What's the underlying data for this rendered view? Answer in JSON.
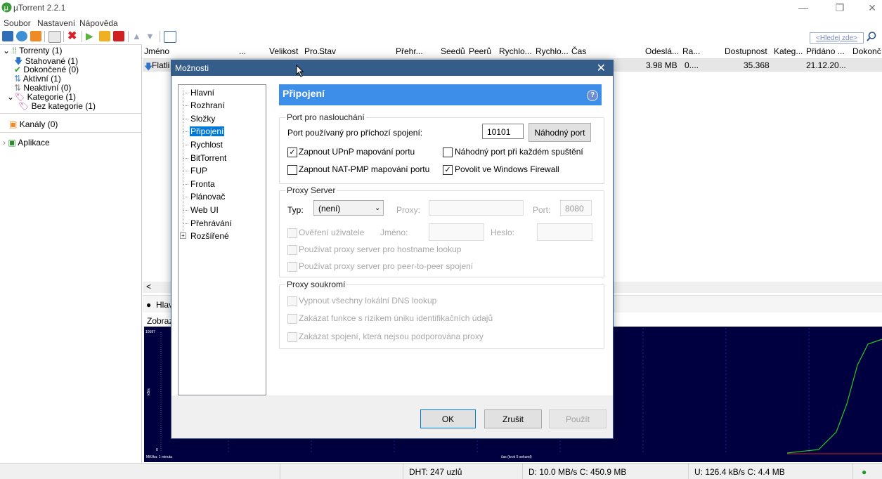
{
  "app": {
    "title": "µTorrent 2.2.1"
  },
  "menu": [
    "Soubor",
    "Nastavení",
    "Nápověda"
  ],
  "search": {
    "placeholder": "<Hledej zde>"
  },
  "sidebar": {
    "torrents": "Torrenty (1)",
    "items": [
      "Stahované (1)",
      "Dokončené (0)",
      "Aktivní (1)",
      "Neaktivní (0)"
    ],
    "categories": "Kategorie (1)",
    "no_category": "Bez kategorie (1)",
    "channels": "Kanály (0)",
    "apps": "Aplikace"
  },
  "grid": {
    "columns": [
      "Jméno",
      "...",
      "Velikost",
      "Pro...",
      "Stav",
      "Přehr...",
      "Seedů",
      "Peerů",
      "Rychlo...",
      "Rychlo...",
      "Čas",
      "Odeslá...",
      "Ra...",
      "Dostupnost",
      "Kateg...",
      "Přidáno ...",
      "Dokonč"
    ],
    "row": {
      "name": "Flatli",
      "uploaded": "3.98 MB",
      "ratio": "0....",
      "availability": "35.368",
      "added": "21.12.20..."
    }
  },
  "lower": {
    "tab": "Hlav",
    "view_label": "Zobraz",
    "graph_ymax": "10587",
    "graph_ylabel": "kB/s",
    "graph_ymin": "0",
    "graph_xleft": "Mřížka: 1 minuta",
    "graph_xmid": "čas (krok 5 sekund)"
  },
  "status": {
    "dht": "DHT: 247 uzlů",
    "download": "D: 10.0 MB/s C: 450.9 MB",
    "upload": "U: 126.4 kB/s C: 4.4 MB"
  },
  "dialog": {
    "title": "Možnosti",
    "tree": [
      "Hlavní",
      "Rozhraní",
      "Složky",
      "Připojení",
      "Rychlost",
      "BitTorrent",
      "FUP",
      "Fronta",
      "Plánovač",
      "Web UI",
      "Přehrávání",
      "Rozšířené"
    ],
    "selected": "Připojení",
    "section_title": "Připojení",
    "help": "?",
    "port_group": {
      "label": "Port pro naslouchání",
      "port_label": "Port používaný pro příchozí spojení:",
      "port_value": "10101",
      "random_port_button": "Náhodný port",
      "upnp": "Zapnout UPnP mapování portu",
      "upnp_checked": true,
      "random_each_start": "Náhodný port při každém spuštění",
      "random_each_start_checked": false,
      "natpmp": "Zapnout NAT-PMP mapování portu",
      "natpmp_checked": false,
      "firewall": "Povolit ve Windows Firewall",
      "firewall_checked": true
    },
    "proxy_group": {
      "label": "Proxy Server",
      "type_label": "Typ:",
      "type_value": "(není)",
      "proxy_label": "Proxy:",
      "port_label": "Port:",
      "port_value": "8080",
      "auth": "Ověření uživatele",
      "name_label": "Jméno:",
      "password_label": "Heslo:",
      "hostname_lookup": "Používat proxy server pro hostname lookup",
      "p2p": "Používat proxy server pro peer-to-peer spojení"
    },
    "privacy_group": {
      "label": "Proxy soukromí",
      "dns": "Vypnout všechny lokální DNS lookup",
      "identify": "Zakázat funkce s rizikem úniku identifikačních údajů",
      "unsupported": "Zakázat spojení, která nejsou podporována proxy"
    },
    "buttons": {
      "ok": "OK",
      "cancel": "Zrušit",
      "apply": "Použít"
    }
  },
  "colors": {
    "accent": "#3c8ee8",
    "dialog_title": "#355d89",
    "selection": "#0078d7",
    "graph_bg": "#000040",
    "graph_line": "#22cc22"
  }
}
